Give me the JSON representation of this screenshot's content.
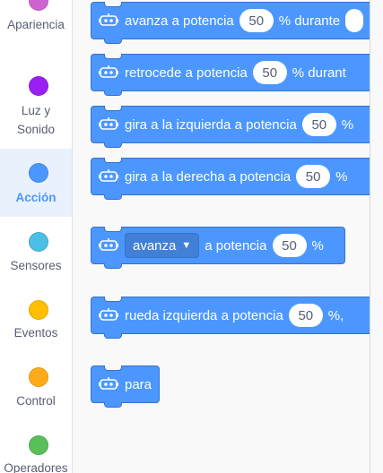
{
  "categories": [
    {
      "name": "looks",
      "label_lines": [
        "Apariencia"
      ],
      "color": "#cf63cf",
      "selected": false
    },
    {
      "name": "light-sound",
      "label_lines": [
        "Luz y",
        "Sonido"
      ],
      "color": "#9a1ff3",
      "selected": false
    },
    {
      "name": "action",
      "label_lines": [
        "Acción"
      ],
      "color": "#4c97ff",
      "selected": true
    },
    {
      "name": "sensors",
      "label_lines": [
        "Sensores"
      ],
      "color": "#4cbfe6",
      "selected": false
    },
    {
      "name": "events",
      "label_lines": [
        "Eventos"
      ],
      "color": "#ffbf00",
      "selected": false
    },
    {
      "name": "control",
      "label_lines": [
        "Control"
      ],
      "color": "#ffab19",
      "selected": false
    },
    {
      "name": "operators",
      "label_lines": [
        "Operadores"
      ],
      "color": "#59c059",
      "selected": false
    }
  ],
  "blocks": {
    "forward": {
      "text": "avanza a potencia",
      "value": "50",
      "tail": "% durante"
    },
    "backward": {
      "text": "retrocede a potencia",
      "value": "50",
      "tail": "% durant"
    },
    "turn_left": {
      "text": "gira a la izquierda a potencia",
      "value": "50",
      "tail": "%"
    },
    "turn_right": {
      "text": "gira a la derecha a potencia",
      "value": "50",
      "tail": "%"
    },
    "move": {
      "dropdown": "avanza",
      "text": "a potencia",
      "value": "50",
      "tail": "%"
    },
    "left_wheel": {
      "text": "rueda izquierda a potencia",
      "value": "50",
      "tail": "%,"
    },
    "stop": {
      "text": "para"
    }
  },
  "colors": {
    "block": "#4c97ff",
    "block_border": "#3373cc",
    "accent": "#4c97ff"
  }
}
